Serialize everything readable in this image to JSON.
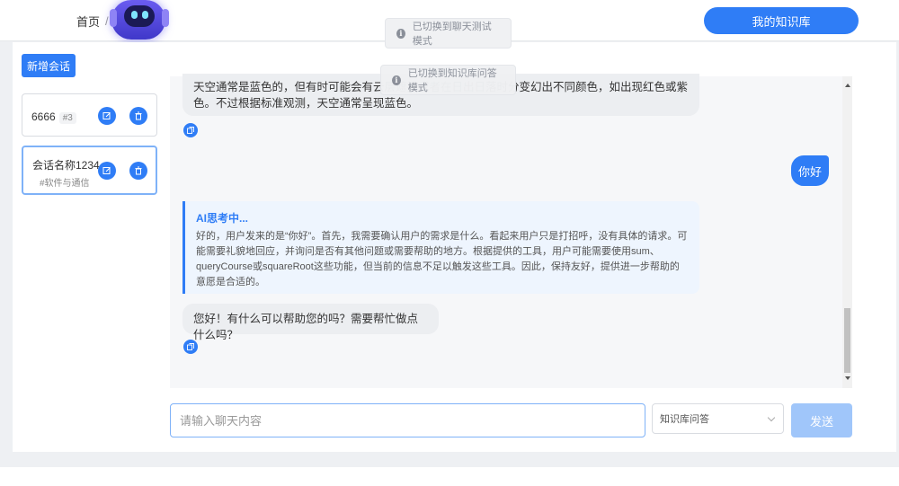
{
  "header": {
    "breadcrumb": [
      "首页",
      "/"
    ],
    "kb_button": "我的知识库"
  },
  "sidebar": {
    "new_session": "新增会话",
    "sessions": [
      {
        "name": "6666",
        "tag": "#3"
      },
      {
        "name": "会话名称1234",
        "tag": "#软件与通信"
      }
    ]
  },
  "toasts": [
    {
      "text": "已切换到聊天测试模式"
    },
    {
      "text": "已切换到知识库问答模式"
    }
  ],
  "messages": {
    "ai_1": "天空通常是蓝色的，但有时可能会有云层遮挡或者在日出日落时分变幻出不同颜色，如出现红色或紫色。不过根据标准观测，天空通常呈现蓝色。",
    "user_1": "你好",
    "thinking_title": "AI思考中...",
    "thinking_text": "好的，用户发来的是“你好”。首先，我需要确认用户的需求是什么。看起来用户只是打招呼，没有具体的请求。可能需要礼貌地回应，并询问是否有其他问题或需要帮助的地方。根据提供的工具，用户可能需要使用sum、queryCourse或squareRoot这些功能，但当前的信息不足以触发这些工具。因此，保持友好，提供进一步帮助的意愿是合适的。",
    "ai_2": "您好！有什么可以帮助您的吗？需要帮忙做点什么吗？"
  },
  "input": {
    "placeholder": "请输入聊天内容",
    "mode": "知识库问答",
    "send": "发送"
  },
  "colors": {
    "accent": "#2f7df6",
    "send_disabled": "#a0c6fa"
  }
}
